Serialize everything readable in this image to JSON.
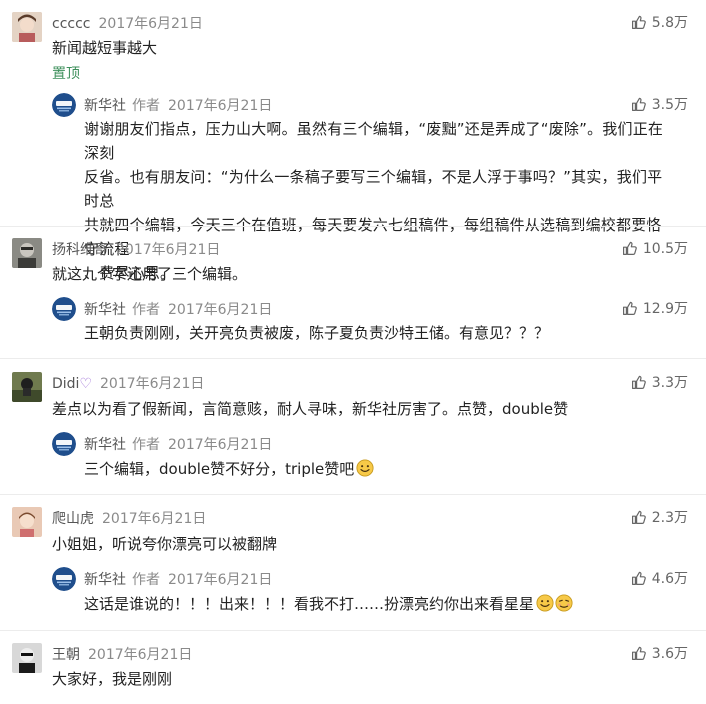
{
  "comments": [
    {
      "user": "ccccc",
      "date": "2017年6月21日",
      "likes": "5.8万",
      "text": "新闻越短事越大",
      "pin_label": "置顶",
      "reply": {
        "user": "新华社",
        "author_tag": "作者",
        "date": "2017年6月21日",
        "likes": "3.5万",
        "lines": [
          "谢谢朋友们指点，压力山大啊。虽然有三个编辑，“废黜”还是弄成了“废除”。我们正在深刻",
          "反省。也有朋友问：“为什么一条稿子要写三个编辑，不是人浮于事吗？”其实，我们平时总",
          "共就四个编辑，今天三个在值班，每天要发六七组稿件，每组稿件从选稿到编校都要恪守流程",
          "、费尽心思。"
        ]
      }
    },
    {
      "user": "扬科维奇",
      "date": "2017年6月21日",
      "likes": "10.5万",
      "text": "就这九个字还用了三个编辑。",
      "reply": {
        "user": "新华社",
        "author_tag": "作者",
        "date": "2017年6月21日",
        "likes": "12.9万",
        "text": "王朝负责刚刚，关开亮负责被废，陈子夏负责沙特王储。有意见？？？"
      }
    },
    {
      "user": "Didi",
      "user_badge": "♡",
      "date": "2017年6月21日",
      "likes": "3.3万",
      "text": "差点以为看了假新闻，言简意赅，耐人寻味，新华社厉害了。点赞，double赞",
      "reply": {
        "user": "新华社",
        "author_tag": "作者",
        "date": "2017年6月21日",
        "likes": "",
        "text": "三个编辑，double赞不好分，triple赞吧"
      }
    },
    {
      "user": "爬山虎",
      "date": "2017年6月21日",
      "likes": "2.3万",
      "text": "小姐姐，听说夸你漂亮可以被翻牌",
      "reply": {
        "user": "新华社",
        "author_tag": "作者",
        "date": "2017年6月21日",
        "likes": "4.6万",
        "text": "这话是谁说的！！！出来！！！看我不打……扮漂亮约你出来看星星"
      }
    },
    {
      "user": "王朝",
      "date": "2017年6月21日",
      "likes": "3.6万",
      "text": "大家好，我是刚刚"
    }
  ],
  "icons": {
    "like": "thumbs-up-icon",
    "emoji": "smiling-face-icon",
    "badge": "xinhua-logo-icon"
  },
  "colors": {
    "pin": "#3d8f5b",
    "meta": "#8a8a8a",
    "badge_heart": "#9b6ad6",
    "xinhua_blue": "#1f4e8c"
  }
}
